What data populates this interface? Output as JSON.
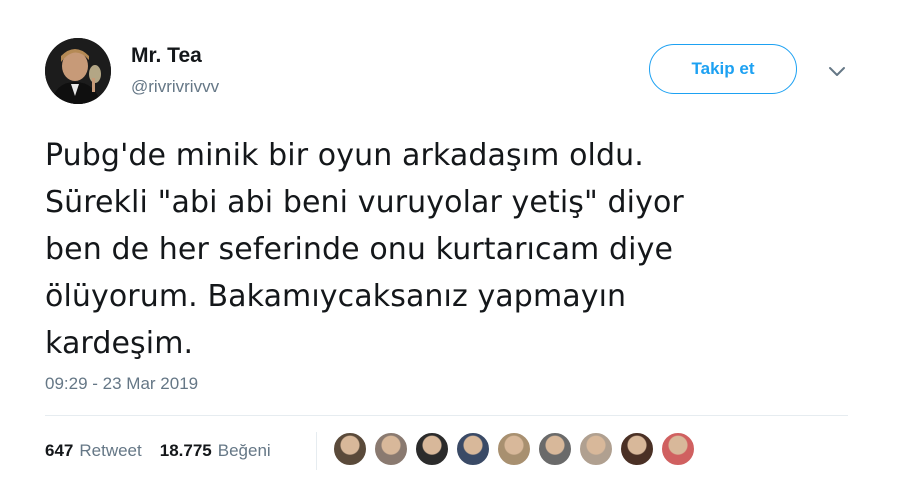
{
  "author": {
    "display_name": "Mr. Tea",
    "handle": "@rivrivrivvv"
  },
  "follow_button": {
    "label": "Takip et"
  },
  "tweet": {
    "lines": [
      "Pubg'de minik bir oyun arkadaşım oldu.",
      "Sürekli \"abi abi beni vuruyolar yetiş\" diyor",
      "ben de her seferinde onu kurtarıcam diye",
      "ölüyorum. Bakamıycaksanız yapmayın",
      "kardeşim."
    ],
    "timestamp": "09:29 - 23 Mar 2019"
  },
  "stats": {
    "retweets": {
      "count": "647",
      "label": "Retweet"
    },
    "likes": {
      "count": "18.775",
      "label": "Beğeni"
    }
  },
  "likers": [
    {
      "color": "#5a4a3a"
    },
    {
      "color": "#8a7a70"
    },
    {
      "color": "#2b2b2b"
    },
    {
      "color": "#3a4a66"
    },
    {
      "color": "#a89070"
    },
    {
      "color": "#6a6a6a"
    },
    {
      "color": "#b0a090"
    },
    {
      "color": "#4a3025"
    },
    {
      "color": "#d06060"
    }
  ],
  "colors": {
    "accent": "#1da1f2",
    "secondary_text": "#657786",
    "primary_text": "#14171a"
  }
}
